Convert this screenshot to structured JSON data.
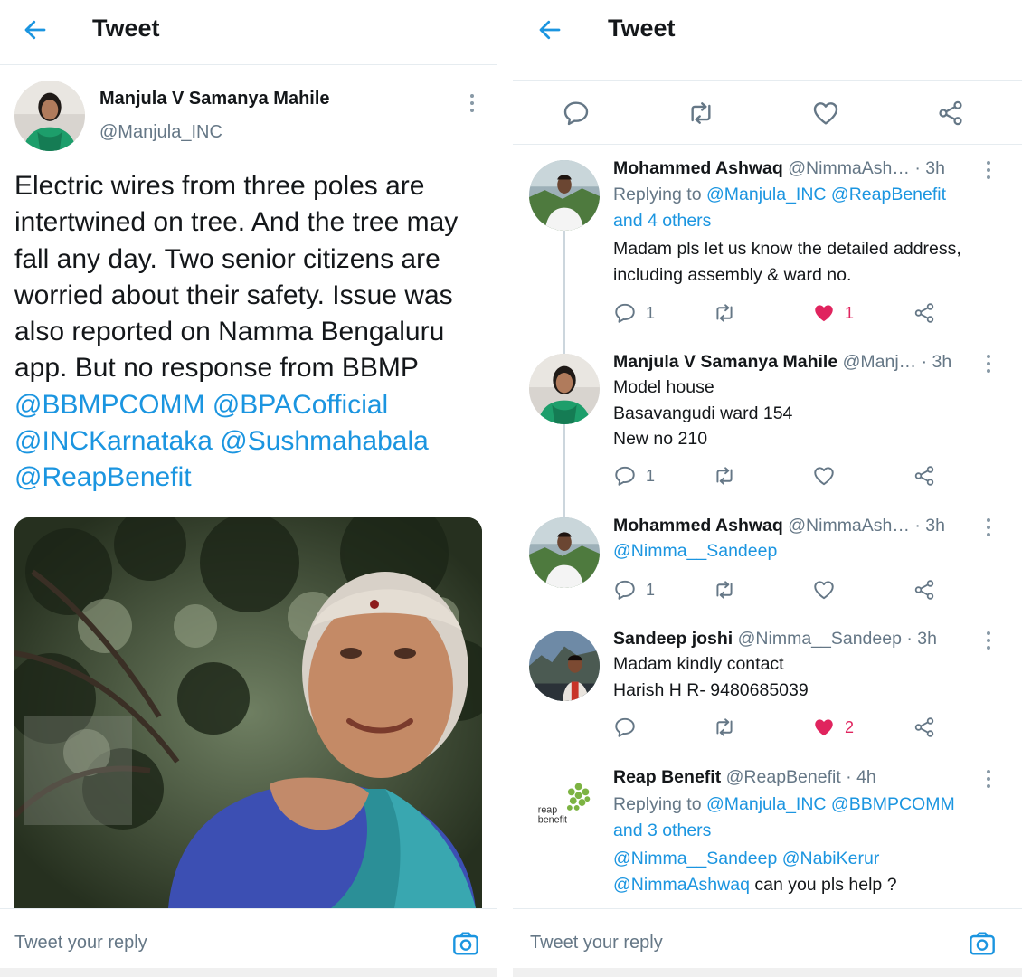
{
  "left": {
    "header": {
      "title": "Tweet"
    },
    "tweet": {
      "author_name": "Manjula V Samanya Mahile",
      "author_handle": "@Manjula_INC",
      "text_plain": "Electric wires from three poles are intertwined on tree. And the tree may fall any day. Two senior citizens are worried about their safety. Issue was also reported on Namma Bengaluru app. But no response from BBMP",
      "mentions": [
        "@BBMPCOMM",
        "@BPACofficial",
        "@INCKarnataka",
        "@Sushmahabala",
        "@ReapBenefit"
      ]
    },
    "reply_bar": {
      "placeholder": "Tweet your reply"
    }
  },
  "right": {
    "header": {
      "title": "Tweet"
    },
    "replies": [
      {
        "name": "Mohammed Ashwaq",
        "handle": "@NimmaAsh…",
        "time": "· 3h",
        "replying_prefix": "Replying to",
        "replying_to": "@Manjula_INC @ReapBenefit",
        "replying_more": "and 4 others",
        "text": "Madam pls let us know the detailed address, including assembly & ward no.",
        "reply_count": "1",
        "like_count": "1",
        "liked": true
      },
      {
        "name": "Manjula V Samanya Mahile",
        "handle": "@Manj…",
        "time": "· 3h",
        "lines": [
          "Model house",
          "Basavangudi ward 154",
          "New no 210"
        ],
        "reply_count": "1",
        "like_count": "",
        "liked": false
      },
      {
        "name": "Mohammed Ashwaq",
        "handle": "@NimmaAsh…",
        "time": "· 3h",
        "mention": "@Nimma__Sandeep",
        "reply_count": "1",
        "like_count": "",
        "liked": false
      },
      {
        "name": "Sandeep joshi",
        "handle": "@Nimma__Sandeep",
        "time": "· 3h",
        "lines": [
          "Madam kindly contact",
          "Harish H R- 9480685039"
        ],
        "reply_count": "",
        "like_count": "2",
        "liked": true
      },
      {
        "name": "Reap Benefit",
        "handle": "@ReapBenefit",
        "time": "· 4h",
        "replying_prefix": "Replying to",
        "replying_to": "@Manjula_INC @BBMPCOMM",
        "replying_more": "and 3 others",
        "mention_1": "@Nimma__Sandeep",
        "mention_2": "@NabiKerur",
        "mention_3": "@NimmaAshwaq",
        "text_tail": "can you pls help ?",
        "logo_text_1": "reap",
        "logo_text_2": "benefit"
      }
    ],
    "reply_bar": {
      "placeholder": "Tweet your reply"
    }
  },
  "colors": {
    "link": "#1b95e0",
    "muted": "#657786",
    "like": "#e0245e",
    "divider": "#e6ecf0"
  },
  "icons": [
    "back-arrow-icon",
    "more-icon",
    "reply-icon",
    "retweet-icon",
    "like-icon",
    "share-icon",
    "camera-icon"
  ]
}
